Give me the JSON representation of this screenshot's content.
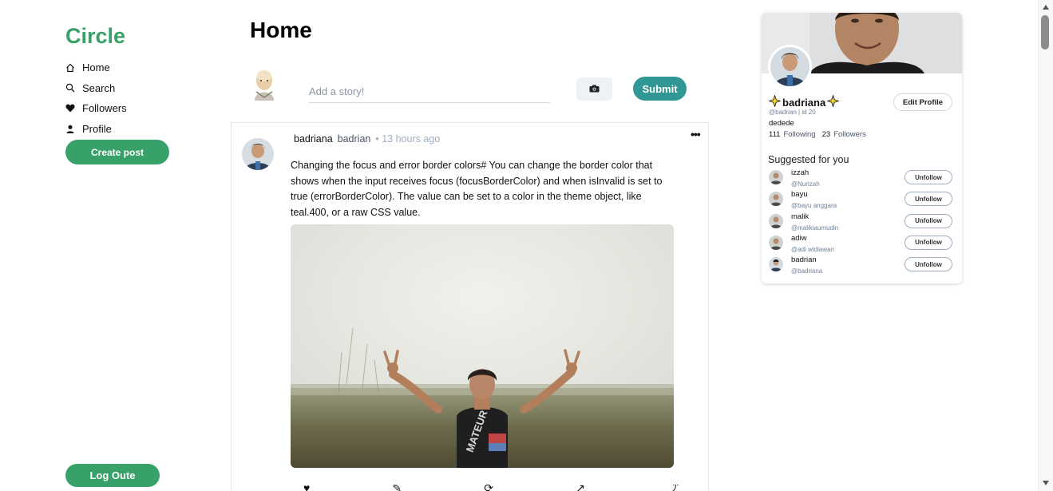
{
  "brand": "Circle",
  "nav": {
    "items": [
      {
        "label": "Home",
        "icon": "home-icon"
      },
      {
        "label": "Search",
        "icon": "search-icon"
      },
      {
        "label": "Followers",
        "icon": "heart-icon"
      },
      {
        "label": "Profile",
        "icon": "person-icon"
      }
    ],
    "create_post": "Create post",
    "logout": "Log Oute"
  },
  "main": {
    "title": "Home",
    "story": {
      "placeholder": "Add a story!",
      "camera_icon": "camera-icon",
      "submit_label": "Submit"
    },
    "post": {
      "name": "badriana",
      "handle": "badrian",
      "time": "• 13 hours ago",
      "menu": "•••",
      "text": "Changing the focus and error border colors# You can change the border color that shows when the input receives focus (focusBorderColor) and when isInvalid is set to true (errorBorderColor). The value can be set to a color in the theme object, like teal.400, or a raw CSS value.",
      "actions": [
        "♥",
        "✎",
        "⟳",
        "↗",
        "⤴"
      ]
    }
  },
  "profile": {
    "name": "badriana",
    "handle": "@badrian | id 20",
    "bio": "dedede",
    "following_count": "111",
    "following_label": "Following",
    "followers_count": "23",
    "followers_label": "Followers",
    "edit_label": "Edit Profile",
    "suggested_title": "Suggested for you",
    "suggestions": [
      {
        "name": "izzah",
        "handle": "@Nurizah",
        "button": "Unfollow"
      },
      {
        "name": "bayu",
        "handle": "@bayu anggara",
        "button": "Unfollow"
      },
      {
        "name": "malik",
        "handle": "@malikiaumudin",
        "button": "Unfollow"
      },
      {
        "name": "adiw",
        "handle": "@adi widiawan",
        "button": "Unfollow"
      },
      {
        "name": "badrian",
        "handle": "@badriana",
        "button": "Unfollow"
      }
    ]
  },
  "colors": {
    "brand": "#38a169",
    "submit": "#319795",
    "text_muted": "#718096"
  }
}
